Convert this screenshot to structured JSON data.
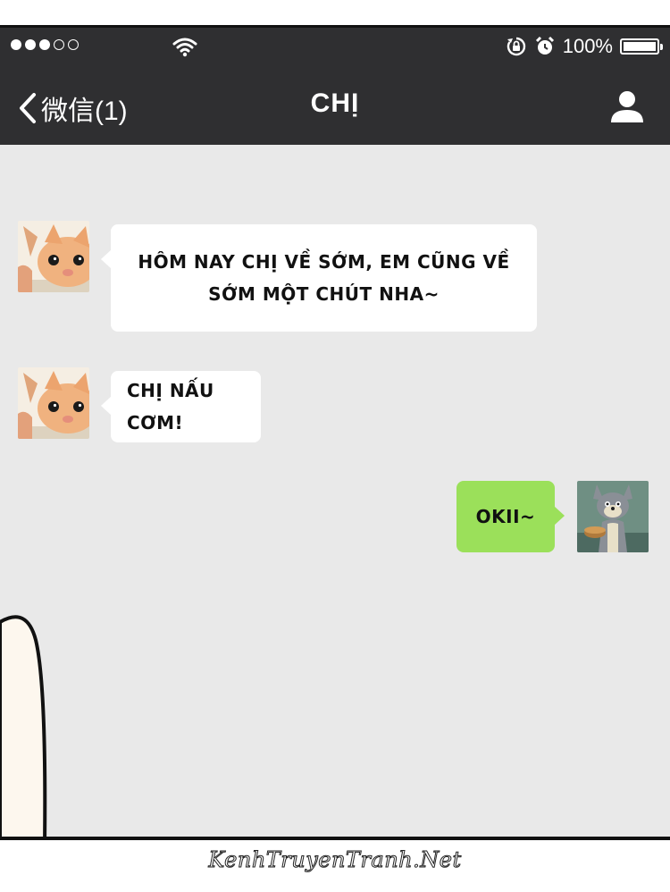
{
  "status_bar": {
    "signal_dots_filled": 3,
    "signal_dots_total": 5,
    "battery": "100%",
    "battery_level": 1.0,
    "icons": [
      "signal-icon",
      "wifi-icon",
      "rotation-lock-icon",
      "alarm-icon",
      "battery-icon"
    ]
  },
  "nav": {
    "back_label": "微信(1)",
    "title": "CHỊ",
    "profile_icon": "person-icon"
  },
  "messages": [
    {
      "sender": "contact",
      "text": "HÔM NAY CHỊ VỀ SỚM, EM CŨNG VỀ SỚM MỘT CHÚT NHA~",
      "avatar": "cat-avatar"
    },
    {
      "sender": "contact",
      "text": "CHỊ NẤU CƠM!",
      "avatar": "cat-avatar"
    },
    {
      "sender": "self",
      "text": "OKII~",
      "avatar": "tom-cat-avatar"
    }
  ],
  "colors": {
    "header": "#2f2f31",
    "chat_background": "#e9e9e9",
    "incoming_bubble": "#ffffff",
    "outgoing_bubble": "#9be05a"
  },
  "watermark": "KenhTruyenTranh.Net"
}
